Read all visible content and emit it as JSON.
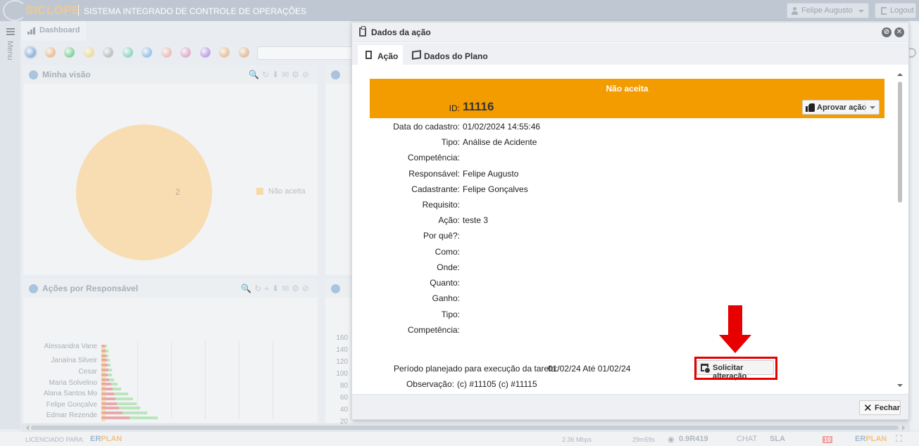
{
  "app": {
    "brand": "SICLOPE",
    "subtitle": "SISTEMA INTEGRADO DE CONTROLE DE OPERAÇÕES",
    "user_name": "Felipe Augusto",
    "logout_label": "Logout",
    "menu_label": "Menu"
  },
  "dashboard": {
    "tab_label": "Dashboard",
    "filter_dot_colors": [
      "#6fa0d8",
      "#f0a050",
      "#40c060",
      "#f0d060",
      "#a0a0a0",
      "#50c8a0",
      "#60a8e0",
      "#f0a090",
      "#e080b0",
      "#a070e0",
      "#f0a060",
      "#e0a060"
    ],
    "panel1_title": "Minha visão",
    "panel1_pie_value": "2",
    "panel1_legend": "Não aceita",
    "panel2_title": "Ações por Responsável",
    "panel2_names": [
      "Alessandra Vane",
      "Janaína Silveir",
      "Cesar",
      "Maria Solvelino",
      "Alana Santos Mo",
      "Felipe Gonçalve",
      "Edmar Rezende"
    ],
    "panel3_y_ticks": [
      "160",
      "140",
      "120",
      "100",
      "80",
      "60",
      "40",
      "20"
    ]
  },
  "footer": {
    "licensed_label": "LICENCIADO PARA:",
    "licensee_a": "ER",
    "licensee_b": "PLAN",
    "speed": "2.36 Mbps",
    "timer": "29m59s",
    "version": "0.9R419",
    "chat": "CHAT",
    "sla": "SLA",
    "badge": "10"
  },
  "modal": {
    "title": "Dados da ação",
    "tabs": [
      {
        "label": "Ação",
        "active": true
      },
      {
        "label": "Dados do Plano",
        "active": false
      }
    ],
    "status": "Não aceita",
    "approve_label": "Aprovar ação",
    "fields": [
      {
        "label": "ID:",
        "value": "11116"
      },
      {
        "label": "Data do cadastro:",
        "value": "01/02/2024 14:55:46"
      },
      {
        "label": "Tipo:",
        "value": "Análise de Acidente"
      },
      {
        "label": "Competência:",
        "value": ""
      },
      {
        "label": "Responsável:",
        "value": "Felipe Augusto"
      },
      {
        "label": "Cadastrante:",
        "value": "Felipe Gonçalves"
      },
      {
        "label": "Requisito:",
        "value": ""
      },
      {
        "label": "Ação:",
        "value": "teste 3"
      },
      {
        "label": "Por quê?:",
        "value": ""
      },
      {
        "label": "Como:",
        "value": ""
      },
      {
        "label": "Onde:",
        "value": ""
      },
      {
        "label": "Quanto:",
        "value": ""
      },
      {
        "label": "Ganho:",
        "value": ""
      },
      {
        "label": "Tipo:",
        "value": ""
      },
      {
        "label": "Competência:",
        "value": ""
      }
    ],
    "period_label": "Período planejado para execução da tarefa:",
    "period_value": "01/02/24 Até 01/02/24",
    "solicitar_label": "Solicitar alteração",
    "observacao_label": "Observação:",
    "observacao_value": "(c) #11105 (c) #11115",
    "close_label": "Fechar"
  }
}
